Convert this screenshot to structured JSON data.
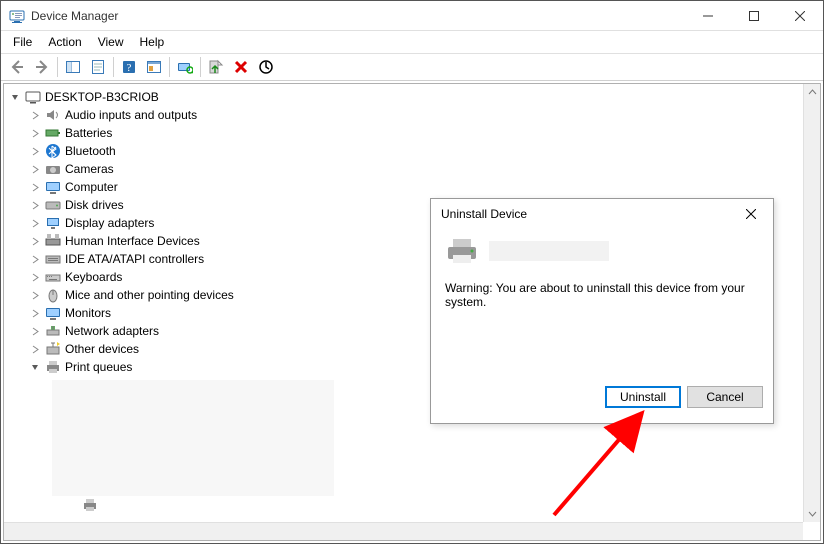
{
  "window": {
    "title": "Device Manager"
  },
  "menubar": {
    "file": "File",
    "action": "Action",
    "view": "View",
    "help": "Help"
  },
  "tree": {
    "root": "DESKTOP-B3CRIOB",
    "items": [
      "Audio inputs and outputs",
      "Batteries",
      "Bluetooth",
      "Cameras",
      "Computer",
      "Disk drives",
      "Display adapters",
      "Human Interface Devices",
      "IDE ATA/ATAPI controllers",
      "Keyboards",
      "Mice and other pointing devices",
      "Monitors",
      "Network adapters",
      "Other devices",
      "Print queues"
    ]
  },
  "dialog": {
    "title": "Uninstall Device",
    "warning": "Warning: You are about to uninstall this device from your system.",
    "uninstall": "Uninstall",
    "cancel": "Cancel"
  }
}
